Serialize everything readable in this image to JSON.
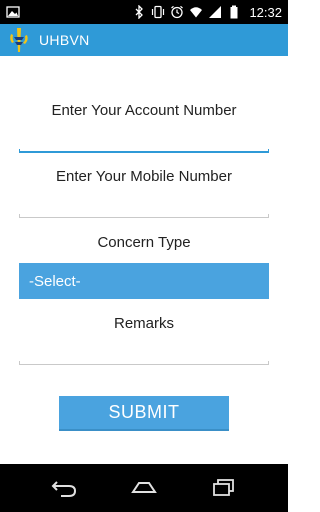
{
  "status_bar": {
    "time": "12:32",
    "icons": [
      "image-icon",
      "bluetooth-icon",
      "vibrate-icon",
      "alarm-icon",
      "wifi-icon",
      "signal-icon",
      "battery-icon"
    ]
  },
  "app_bar": {
    "title": "UHBVN",
    "logo": "uhbvn-logo-icon",
    "color": "#2f9ad7"
  },
  "form": {
    "account_label": "Enter Your Account Number",
    "account_value": "",
    "mobile_label": "Enter Your Mobile Number",
    "mobile_value": "",
    "concern_label": "Concern Type",
    "concern_selected": "-Select-",
    "remarks_label": "Remarks",
    "remarks_value": "",
    "submit_label": "SUBMIT",
    "accent_color": "#4aa3df"
  },
  "nav_bar": {
    "buttons": [
      "back-icon",
      "home-icon",
      "recent-apps-icon"
    ]
  }
}
